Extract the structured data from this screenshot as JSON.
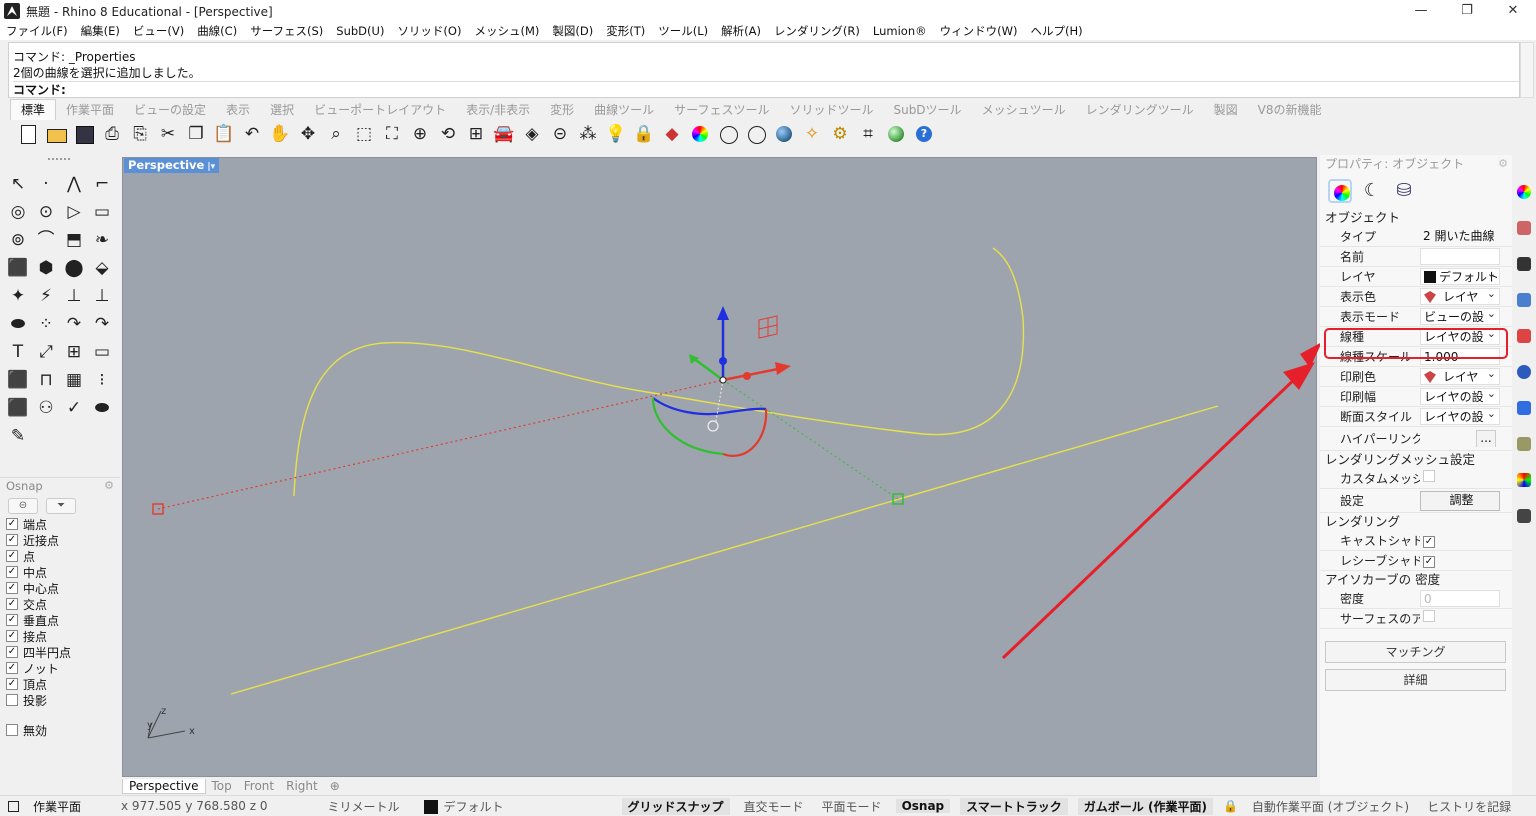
{
  "window": {
    "title": "無題 - Rhino 8 Educational - [Perspective]",
    "controls": [
      "—",
      "❐",
      "✕"
    ]
  },
  "menu": [
    "ファイル(F)",
    "編集(E)",
    "ビュー(V)",
    "曲線(C)",
    "サーフェス(S)",
    "SubD(U)",
    "ソリッド(O)",
    "メッシュ(M)",
    "製図(D)",
    "変形(T)",
    "ツール(L)",
    "解析(A)",
    "レンダリング(R)",
    "Lumion®",
    "ウィンドウ(W)",
    "ヘルプ(H)"
  ],
  "command": {
    "line1": "コマンド: _Properties",
    "line2": "2個の曲線を選択に追加しました。",
    "prompt": "コマンド:"
  },
  "toolbar_tabs": [
    "標準",
    "作業平面",
    "ビューの設定",
    "表示",
    "選択",
    "ビューポートレイアウト",
    "表示/非表示",
    "変形",
    "曲線ツール",
    "サーフェスツール",
    "ソリッドツール",
    "SubDツール",
    "メッシュツール",
    "レンダリングツール",
    "製図",
    "V8の新機能"
  ],
  "toolbar_icons": [
    "new-document",
    "open-folder",
    "save",
    "print",
    "import",
    "cut",
    "copy",
    "paste",
    "undo",
    "pan",
    "rotate-view",
    "zoom-dynamic",
    "zoom-window",
    "zoom-extents",
    "zoom-selected",
    "rotate-camera",
    "four-viewports",
    "car",
    "plane-tool",
    "cplane",
    "snap-points",
    "light-bulb",
    "lock",
    "layer",
    "color-wheel",
    "wireframe-sphere",
    "rendered-sphere",
    "blue-sphere",
    "rendered-light",
    "gear",
    "fillet-tool",
    "green-ball",
    "help"
  ],
  "left_tools": [
    "↖",
    "·",
    "⋀",
    "⌐",
    "◎",
    "⊙",
    "▷",
    "▭",
    "⊚",
    "⌒",
    "⬒",
    "❧",
    "⬛",
    "⬢",
    "⬤",
    "⬙",
    "✦",
    "⚡",
    "⊥",
    "⊥",
    "⬬",
    "⁘",
    "↷",
    "↷",
    "T",
    "⤢",
    "⊞",
    "▭",
    "⬛",
    "⊓",
    "▦",
    "⁝",
    "⬛",
    "⚇",
    "✓",
    "⬬",
    "✎"
  ],
  "osnap": {
    "title": "Osnap",
    "items": [
      {
        "label": "端点",
        "checked": true
      },
      {
        "label": "近接点",
        "checked": true
      },
      {
        "label": "点",
        "checked": true
      },
      {
        "label": "中点",
        "checked": true
      },
      {
        "label": "中心点",
        "checked": true
      },
      {
        "label": "交点",
        "checked": true
      },
      {
        "label": "垂直点",
        "checked": true
      },
      {
        "label": "接点",
        "checked": true
      },
      {
        "label": "四半円点",
        "checked": true
      },
      {
        "label": "ノット",
        "checked": true
      },
      {
        "label": "頂点",
        "checked": true
      },
      {
        "label": "投影",
        "checked": false
      }
    ],
    "disable": {
      "label": "無効",
      "checked": false
    }
  },
  "viewport": {
    "label": "Perspective",
    "axis_x": "x",
    "axis_y": "y",
    "axis_z": "z",
    "tabs": [
      "Perspective",
      "Top",
      "Front",
      "Right",
      "⊕"
    ],
    "colors": {
      "background": "#9ea4ad",
      "curve": "#e8e14a",
      "gumball_x": "#e23b2e",
      "gumball_y": "#2fbf2f",
      "gumball_z": "#1f2ee0",
      "annotation": "#e5202a"
    }
  },
  "properties": {
    "title": "プロパティ: オブジェクト",
    "sections": {
      "object": "オブジェクト",
      "render_mesh": "レンダリングメッシュ設定",
      "rendering": "レンダリング",
      "isocurve": "アイソカーブの 密度"
    },
    "rows": {
      "type": {
        "label": "タイプ",
        "value": "2 開いた曲線"
      },
      "name": {
        "label": "名前",
        "value": ""
      },
      "layer": {
        "label": "レイヤ",
        "value": "デフォルト"
      },
      "display_color": {
        "label": "表示色",
        "value": "レイヤ"
      },
      "display_mode": {
        "label": "表示モード",
        "value": "ビューの設"
      },
      "linetype": {
        "label": "線種",
        "value": "レイヤの設"
      },
      "linetype_scale": {
        "label": "線種スケール",
        "value": "1.000"
      },
      "print_color": {
        "label": "印刷色",
        "value": "レイヤ"
      },
      "print_width": {
        "label": "印刷幅",
        "value": "レイヤの設"
      },
      "section_style": {
        "label": "断面スタイル",
        "value": "レイヤの設"
      },
      "hyperlink": {
        "label": "ハイパーリンク",
        "value": "..."
      },
      "custom_mesh": {
        "label": "カスタムメッシ",
        "value": ""
      },
      "settings": {
        "label": "設定",
        "value": "調整"
      },
      "cast_shadow": {
        "label": "キャストシャドウ",
        "value": "✓"
      },
      "receive_shadow": {
        "label": "レシーブシャドウ",
        "value": "✓"
      },
      "density": {
        "label": "密度",
        "value": "0"
      },
      "surface_iso": {
        "label": "サーフェスのア",
        "value": ""
      }
    },
    "buttons": {
      "match": "マッチング",
      "details": "詳細"
    }
  },
  "status": {
    "cplane": "作業平面",
    "coords": "x 977.505  y 768.580  z 0",
    "units": "ミリメートル",
    "layer": "デフォルト",
    "grid_snap": "グリッドスナップ",
    "ortho": "直交モード",
    "planar": "平面モード",
    "osnap": "Osnap",
    "smart_track": "スマートトラック",
    "gumball": "ガムボール (作業平面)",
    "auto_cplane": "自動作業平面 (オブジェクト)",
    "history": "ヒストリを記録"
  }
}
